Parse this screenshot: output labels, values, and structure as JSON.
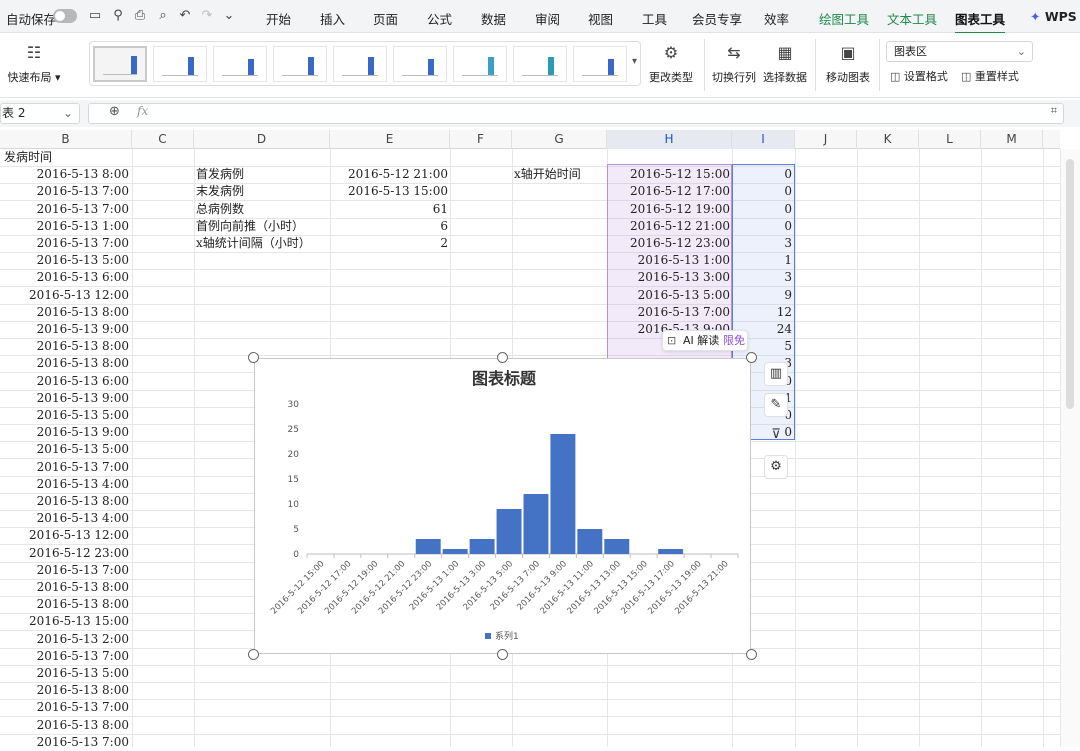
{
  "menubar": {
    "autosave_label": "自动保存",
    "tabs": [
      "开始",
      "插入",
      "页面",
      "公式",
      "数据",
      "审阅",
      "视图",
      "工具",
      "会员专享",
      "效率"
    ],
    "context_tabs": [
      "绘图工具",
      "文本工具",
      "图表工具"
    ],
    "wps_label": "WPS A"
  },
  "ribbon": {
    "quick_layout_label": "快速布局",
    "change_type_label": "更改类型",
    "switch_rowcol_label": "切换行列",
    "select_data_label": "选择数据",
    "move_chart_label": "移动图表",
    "area_select_value": "图表区",
    "format_label": "设置格式",
    "reset_style_label": "重置样式"
  },
  "formula_bar": {
    "name_box": "表 2",
    "fx_label": "fx",
    "content": ""
  },
  "columns": [
    "B",
    "C",
    "D",
    "E",
    "F",
    "G",
    "H",
    "I",
    "J",
    "K",
    "L",
    "M"
  ],
  "column_b": {
    "header": "发病时间",
    "values": [
      "2016-5-13 8:00",
      "2016-5-13 7:00",
      "2016-5-13 7:00",
      "2016-5-13 1:00",
      "2016-5-13 7:00",
      "2016-5-13 5:00",
      "2016-5-13 6:00",
      "2016-5-13 12:00",
      "2016-5-13 8:00",
      "2016-5-13 9:00",
      "2016-5-13 8:00",
      "2016-5-13 8:00",
      "2016-5-13 6:00",
      "2016-5-13 9:00",
      "2016-5-13 5:00",
      "2016-5-13 9:00",
      "2016-5-13 5:00",
      "2016-5-13 7:00",
      "2016-5-13 4:00",
      "2016-5-13 8:00",
      "2016-5-13 4:00",
      "2016-5-13 12:00",
      "2016-5-12 23:00",
      "2016-5-13 7:00",
      "2016-5-13 8:00",
      "2016-5-13 8:00",
      "2016-5-13 15:00",
      "2016-5-13 2:00",
      "2016-5-13 7:00",
      "2016-5-13 5:00",
      "2016-5-13 8:00",
      "2016-5-13 7:00",
      "2016-5-13 8:00",
      "2016-5-13 7:00"
    ]
  },
  "stats": [
    {
      "label": "首发病例",
      "value": "2016-5-12 21:00"
    },
    {
      "label": "末发病例",
      "value": "2016-5-13 15:00"
    },
    {
      "label": "总病例数",
      "value": "61"
    },
    {
      "label": "首例向前推（小时）",
      "value": "6"
    },
    {
      "label": "x轴统计间隔（小时）",
      "value": "2"
    }
  ],
  "axis_start_label": "x轴开始时间",
  "column_h": [
    "2016-5-12 15:00",
    "2016-5-12 17:00",
    "2016-5-12 19:00",
    "2016-5-12 21:00",
    "2016-5-12 23:00",
    "2016-5-13 1:00",
    "2016-5-13 3:00",
    "2016-5-13 5:00",
    "2016-5-13 7:00",
    "2016-5-13 9:00",
    "2016-5-"
  ],
  "column_i": [
    "0",
    "0",
    "0",
    "0",
    "3",
    "1",
    "3",
    "9",
    "12",
    "24",
    "5",
    "3",
    "0",
    "1",
    "0",
    "0"
  ],
  "ai_badge": {
    "label": "AI 解读",
    "tag": "限免"
  },
  "chart_data": {
    "type": "bar",
    "title": "图表标题",
    "categories": [
      "2016-5-12 15:00",
      "2016-5-12 17:00",
      "2016-5-12 19:00",
      "2016-5-12 21:00",
      "2016-5-12 23:00",
      "2016-5-13 1:00",
      "2016-5-13 3:00",
      "2016-5-13 5:00",
      "2016-5-13 7:00",
      "2016-5-13 9:00",
      "2016-5-13 11:00",
      "2016-5-13 13:00",
      "2016-5-13 15:00",
      "2016-5-13 17:00",
      "2016-5-13 19:00",
      "2016-5-13 21:00"
    ],
    "series": [
      {
        "name": "系列1",
        "values": [
          0,
          0,
          0,
          0,
          3,
          1,
          3,
          9,
          12,
          24,
          5,
          3,
          0,
          1,
          0,
          0
        ]
      }
    ],
    "yticks": [
      "0",
      "5",
      "10",
      "15",
      "20",
      "25",
      "30"
    ],
    "ylim": [
      0,
      30
    ],
    "xlabel": "",
    "ylabel": "",
    "grid": false,
    "legend": "bottom",
    "bar_color": "#4472c4"
  }
}
